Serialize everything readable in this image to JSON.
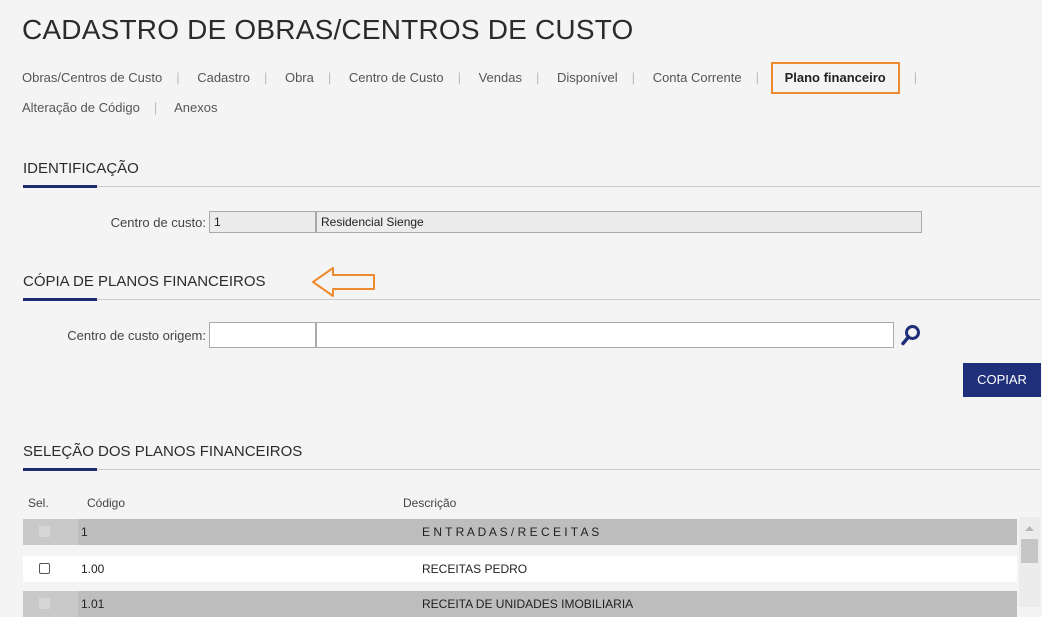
{
  "page": {
    "title": "CADASTRO DE OBRAS/CENTROS DE CUSTO"
  },
  "tabs": [
    {
      "label": "Obras/Centros de Custo"
    },
    {
      "label": "Cadastro"
    },
    {
      "label": "Obra"
    },
    {
      "label": "Centro de Custo"
    },
    {
      "label": "Vendas"
    },
    {
      "label": "Disponível"
    },
    {
      "label": "Conta Corrente"
    },
    {
      "label": "Plano financeiro",
      "active": true
    },
    {
      "label": "Alteração de Código"
    },
    {
      "label": "Anexos"
    }
  ],
  "identificacao": {
    "title": "IDENTIFICAÇÃO",
    "centro_custo_label": "Centro de custo:",
    "centro_custo_code": "1",
    "centro_custo_name": "Residencial Sienge"
  },
  "copia": {
    "title": "CÓPIA DE PLANOS FINANCEIROS",
    "origem_label": "Centro de custo origem:",
    "origem_code": "",
    "origem_name": "",
    "copy_button": "COPIAR"
  },
  "selecao": {
    "title": "SELEÇÃO DOS PLANOS FINANCEIROS",
    "columns": {
      "sel": "Sel.",
      "codigo": "Código",
      "descricao": "Descrição"
    },
    "rows": [
      {
        "codigo": "1",
        "descricao": "E N T R A D A S / R E C E I T A S",
        "group": true
      },
      {
        "codigo": "1.00",
        "descricao": "RECEITAS PEDRO",
        "group": false
      },
      {
        "codigo": "1.01",
        "descricao": "RECEITA DE UNIDADES IMOBILIARIA",
        "group": true
      }
    ]
  },
  "colors": {
    "accent": "#1f2f7a",
    "highlight": "#f08a30"
  }
}
